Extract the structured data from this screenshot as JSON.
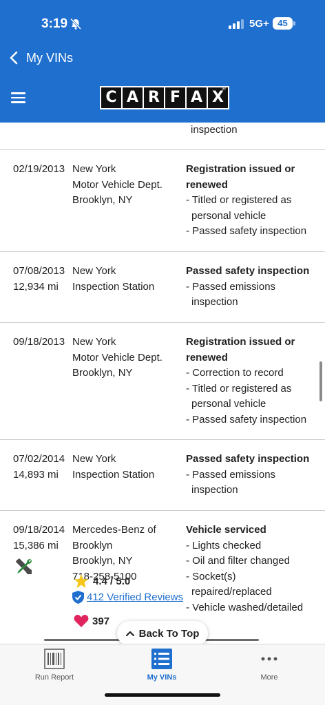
{
  "status_bar": {
    "time": "3:19",
    "network": "5G+",
    "battery": "45"
  },
  "nav": {
    "back_label": "My VINs"
  },
  "header": {
    "logo_letters": [
      "C",
      "A",
      "R",
      "F",
      "A",
      "X"
    ],
    "logo_reg": "®"
  },
  "top_fragment": "inspection",
  "records": [
    {
      "date": "02/19/2013",
      "mileage": "",
      "source": [
        "New York",
        "Motor Vehicle Dept.",
        "Brooklyn, NY"
      ],
      "title_lines": [
        "Registration issued or",
        "renewed"
      ],
      "items": [
        "- Titled or registered as personal vehicle",
        "- Passed safety inspection"
      ]
    },
    {
      "date": "07/08/2013",
      "mileage": "12,934 mi",
      "source": [
        "New York",
        "Inspection Station"
      ],
      "title_lines": [
        "Passed safety inspection"
      ],
      "items": [
        "- Passed emissions inspection"
      ]
    },
    {
      "date": "09/18/2013",
      "mileage": "",
      "source": [
        "New York",
        "Motor Vehicle Dept.",
        "Brooklyn, NY"
      ],
      "title_lines": [
        "Registration issued or",
        "renewed"
      ],
      "items": [
        "- Correction to record",
        "- Titled or registered as personal vehicle",
        "- Passed safety inspection"
      ]
    },
    {
      "date": "07/02/2014",
      "mileage": "14,893 mi",
      "source": [
        "New York",
        "Inspection Station"
      ],
      "title_lines": [
        "Passed safety inspection"
      ],
      "items": [
        "- Passed emissions inspection"
      ]
    },
    {
      "date": "09/18/2014",
      "mileage": "15,386 mi",
      "source": [
        "Mercedes-Benz of",
        "Brooklyn",
        "Brooklyn, NY",
        "718-258-5100"
      ],
      "title_lines": [
        "Vehicle serviced"
      ],
      "items": [
        "- Lights checked",
        "- Oil and filter changed",
        "- Socket(s) repaired/replaced",
        "- Vehicle washed/detailed"
      ],
      "rating": "4.4 / 5.0",
      "reviews": "412 Verified Reviews",
      "favorites": "397"
    }
  ],
  "back_to_top": "Back To Top",
  "tabs": {
    "run_report": "Run Report",
    "my_vins": "My VINs",
    "more": "More"
  },
  "colors": {
    "brand_blue": "#1f6fcf",
    "star": "#f5c518",
    "heart": "#e0245e",
    "wrench_green": "#2e8b3e"
  }
}
